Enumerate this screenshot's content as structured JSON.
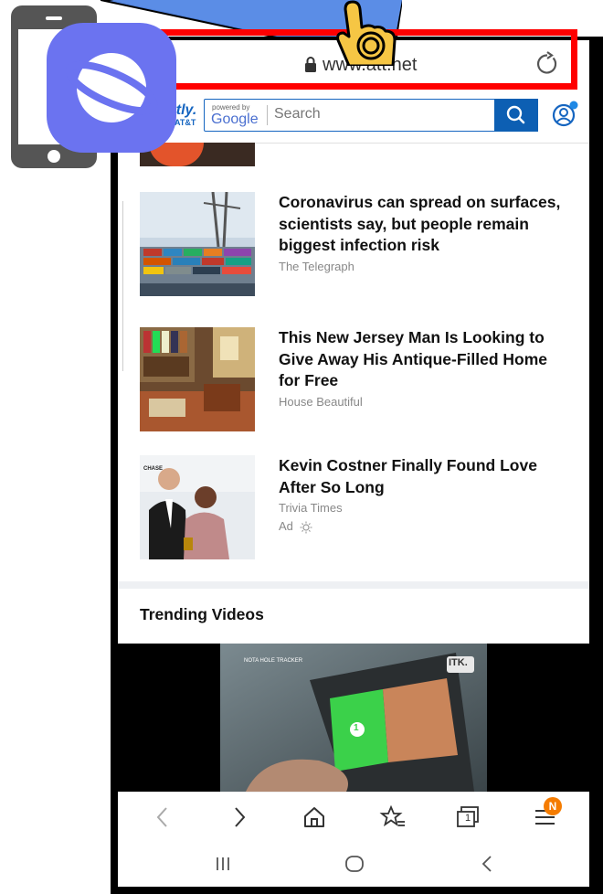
{
  "browser": {
    "url": "www.att.net",
    "brand": "ntly.",
    "brand_sub": "AT&T",
    "powered_by": "powered by",
    "google": "Google",
    "search_placeholder": "Search"
  },
  "articles": [
    {
      "title": "Coronavirus can spread on surfaces, scientists say, but people remain biggest infection risk",
      "source": "The Telegraph"
    },
    {
      "title": "This New Jersey Man Is Looking to Give Away His Antique-Filled Home for Free",
      "source": "House Beautiful"
    },
    {
      "title": "Kevin Costner Finally Found Love After So Long",
      "source": "Trivia Times",
      "ad_label": "Ad"
    }
  ],
  "sections": {
    "trending": "Trending Videos"
  },
  "video": {
    "overlay_tag": "ITK.",
    "brand_caption": "NOTA HOLE TRACKER",
    "tile_number": "1"
  },
  "thumb_text": {
    "chase": "CHASE"
  },
  "nav": {
    "tabs_count": "1",
    "menu_badge": "N"
  },
  "colors": {
    "accent_blue": "#0d5fb3",
    "highlight_red": "#ff0000",
    "app_icon_purple": "#6b73f0",
    "badge_orange": "#f57c00"
  }
}
